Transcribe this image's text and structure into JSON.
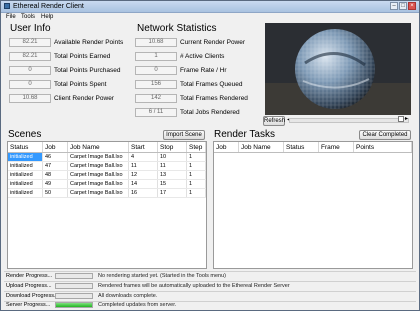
{
  "window": {
    "title": "Ethereal Render Client"
  },
  "menu": [
    "File",
    "Tools",
    "Help"
  ],
  "user_info": {
    "title": "User Info",
    "rows": [
      {
        "value": "82.21",
        "label": "Available Render Points"
      },
      {
        "value": "82.21",
        "label": "Total Points Earned"
      },
      {
        "value": "0",
        "label": "Total Points Purchased"
      },
      {
        "value": "0",
        "label": "Total Points Spent"
      },
      {
        "value": "10.68",
        "label": "Client Render Power"
      }
    ]
  },
  "network": {
    "title": "Network Statistics",
    "rows": [
      {
        "value": "10.68",
        "label": "Current Render Power"
      },
      {
        "value": "1",
        "label": "# Active Clients"
      },
      {
        "value": "0",
        "label": "Frame Rate / Hr"
      },
      {
        "value": "156",
        "label": "Total Frames Queued"
      },
      {
        "value": "142",
        "label": "Total Frames Rendered"
      },
      {
        "value": "6 / 11",
        "label": "Total Jobs Rendered"
      }
    ]
  },
  "preview": {
    "refresh_label": "Refresh"
  },
  "scenes": {
    "title": "Scenes",
    "import_label": "Import Scene",
    "columns": [
      "Status",
      "Job",
      "Job Name",
      "Start",
      "Stop",
      "Step"
    ],
    "rows": [
      [
        "initialized",
        "46",
        "Carpet Image Ball.lxo",
        "4",
        "10",
        "1"
      ],
      [
        "initialized",
        "47",
        "Carpet Image Ball.lxo",
        "11",
        "11",
        "1"
      ],
      [
        "initialized",
        "48",
        "Carpet Image Ball.lxo",
        "12",
        "13",
        "1"
      ],
      [
        "initialized",
        "49",
        "Carpet Image Ball.lxo",
        "14",
        "15",
        "1"
      ],
      [
        "initialized",
        "50",
        "Carpet Image Ball.lxo",
        "16",
        "17",
        "1"
      ]
    ]
  },
  "render_tasks": {
    "title": "Render Tasks",
    "clear_label": "Clear Completed",
    "columns": [
      "Job",
      "Job Name",
      "Status",
      "Frame",
      "Points"
    ]
  },
  "progress": [
    {
      "label": "Render Progress...",
      "fill": 0,
      "text": "No rendering started yet.  (Started in the Tools menu)"
    },
    {
      "label": "Upload Progress...",
      "fill": 0,
      "text": "Rendered frames will be automatically uploaded to the Ethereal Render Server"
    },
    {
      "label": "Download Progress...",
      "fill": 0,
      "text": "All downloads complete."
    },
    {
      "label": "Server Progress...",
      "fill": 1.0,
      "text": "Completed updates from server."
    }
  ],
  "colors": {
    "selected_row": "#3399ff",
    "progress_fill": "#22b422"
  }
}
